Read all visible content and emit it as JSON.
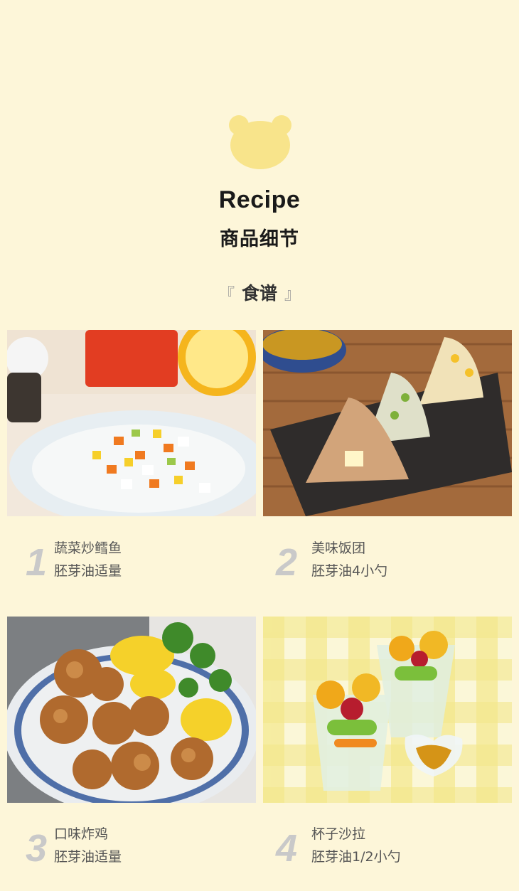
{
  "header": {
    "title_en": "Recipe",
    "title_cn": "商品细节",
    "section_title": "食谱",
    "bracket_left": "『",
    "bracket_right": "』",
    "logo_icon": "bear-head-icon",
    "logo_color": "#f8e48b"
  },
  "recipes": [
    {
      "number": "1",
      "name": "蔬菜炒鳕鱼",
      "oil": "胚芽油适量"
    },
    {
      "number": "2",
      "name": "美味饭团",
      "oil": "胚芽油4小勺"
    },
    {
      "number": "3",
      "name": "口味炸鸡",
      "oil": "胚芽油适量"
    },
    {
      "number": "4",
      "name": "杯子沙拉",
      "oil": "胚芽油1/2小勺"
    }
  ]
}
